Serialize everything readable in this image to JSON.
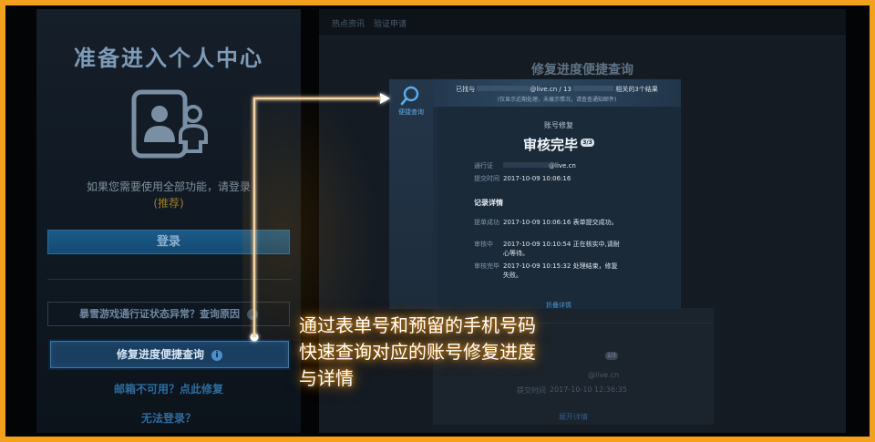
{
  "left_panel": {
    "title": "准备进入个人中心",
    "notice": "如果您需要使用全部功能，请登录",
    "recommend": "(推荐)",
    "login_button": "登录",
    "status_button": "暴雪游戏通行证状态异常？查询原因",
    "repair_button": "修复进度便捷查询",
    "info_icon": "i",
    "mail_link": "邮箱不可用？点此修复",
    "cannot_login_link": "无法登录？"
  },
  "right_page": {
    "tabs": [
      "热点资讯",
      "验证申请"
    ],
    "title": "修复进度便捷查询",
    "bg_card": {
      "badge": "2/3",
      "email_suffix": "@live.cn",
      "submit_label": "提交时间",
      "submit_time": "2017-10-10 12:36:35",
      "expand_link": "展开详情"
    }
  },
  "popup": {
    "sidebar_label": "便捷查询",
    "found_prefix": "已找与",
    "found_mid": "@live.cn / 13",
    "found_suffix": "相关的3个结果",
    "tip": "(仅显示近期处理，未展示情况，请查查通知邮件)",
    "account_repair_label": "账号修复",
    "status": "审核完毕",
    "step_badge": "3/3",
    "passport_label": "通行证",
    "passport_value": "@live.cn",
    "submit_time_label": "提交时间",
    "submit_time_value": "2017-10-09 10:06:16",
    "record_title": "记录详情",
    "records": [
      {
        "stage": "提单成功",
        "text": "2017-10-09 10:06:16 表单提交成功。"
      },
      {
        "stage": "审核中",
        "text": "2017-10-09 10:10:54 正在核实中,请耐心等待。"
      },
      {
        "stage": "审核完毕",
        "text": "2017-10-09 10:15:32 处理结束，修复失败。"
      }
    ],
    "collapse_link": "折叠详情"
  },
  "caption": {
    "line1": "通过表单号和预留的手机号码",
    "line2": "快速查询对应的账号修复进度",
    "line3": "与详情"
  },
  "colors": {
    "frame": "#f1a11b",
    "glow": "#d98a15",
    "accent_blue": "#4b93d1"
  },
  "icons": [
    "user-card-icon",
    "search-icon",
    "info-icon"
  ]
}
